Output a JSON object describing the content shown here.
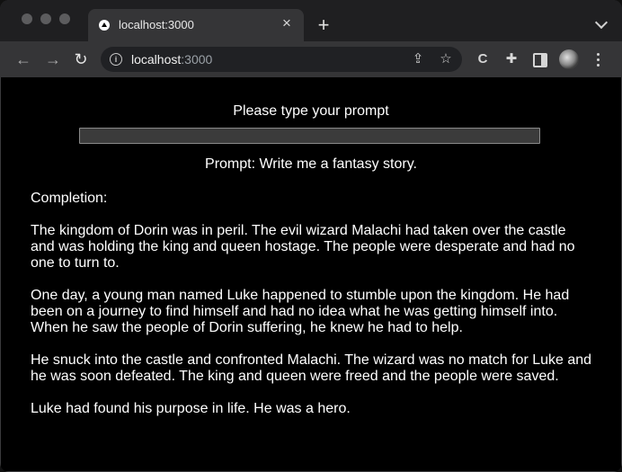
{
  "browser": {
    "tab_title": "localhost:3000",
    "url_host": "localhost",
    "url_port": ":3000"
  },
  "page": {
    "prompt_label": "Please type your prompt",
    "input_value": "",
    "prompt_echo": "Prompt: Write me a fantasy story.",
    "completion_label": "Completion:",
    "paragraphs": [
      "The kingdom of Dorin was in peril. The evil wizard Malachi had taken over the castle and was holding the king and queen hostage. The people were desperate and had no one to turn to.",
      "One day, a young man named Luke happened to stumble upon the kingdom. He had been on a journey to find himself and had no idea what he was getting himself into. When he saw the people of Dorin suffering, he knew he had to help.",
      "He snuck into the castle and confronted Malachi. The wizard was no match for Luke and he was soon defeated. The king and queen were freed and the people were saved.",
      "Luke had found his purpose in life. He was a hero."
    ]
  }
}
